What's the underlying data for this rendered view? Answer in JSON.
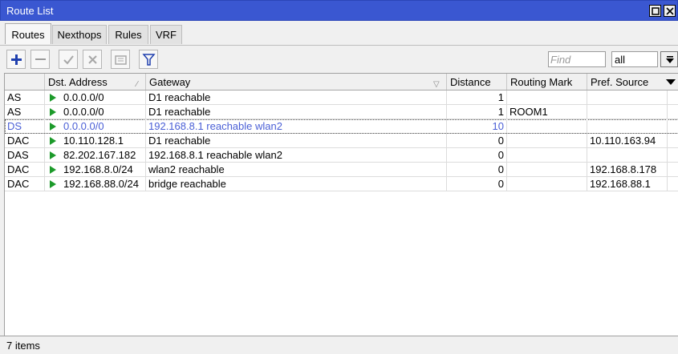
{
  "window": {
    "title": "Route List"
  },
  "tabs": [
    {
      "label": "Routes",
      "active": true
    },
    {
      "label": "Nexthops",
      "active": false
    },
    {
      "label": "Rules",
      "active": false
    },
    {
      "label": "VRF",
      "active": false
    }
  ],
  "toolbar": {
    "buttons": [
      "add-icon",
      "remove-icon",
      "enable-icon",
      "disable-icon",
      "comment-icon",
      "filter-icon"
    ],
    "find_placeholder": "Find",
    "filter_select_value": "all"
  },
  "columns": [
    "",
    "Dst. Address",
    "Gateway",
    "Distance",
    "Routing Mark",
    "Pref. Source"
  ],
  "rows": [
    {
      "flags": "AS",
      "dst": "0.0.0.0/0",
      "gateway": "D1 reachable",
      "distance": "1",
      "mark": "",
      "pref": "",
      "state": "normal"
    },
    {
      "flags": "AS",
      "dst": "0.0.0.0/0",
      "gateway": "D1 reachable",
      "distance": "1",
      "mark": "ROOM1",
      "pref": "",
      "state": "normal"
    },
    {
      "flags": "DS",
      "dst": "0.0.0.0/0",
      "gateway": "192.168.8.1 reachable wlan2",
      "distance": "10",
      "mark": "",
      "pref": "",
      "state": "selected-dim"
    },
    {
      "flags": "DAC",
      "dst": "10.110.128.1",
      "gateway": "D1 reachable",
      "distance": "0",
      "mark": "",
      "pref": "10.110.163.94",
      "state": "normal"
    },
    {
      "flags": "DAS",
      "dst": "82.202.167.182",
      "gateway": "192.168.8.1 reachable wlan2",
      "distance": "0",
      "mark": "",
      "pref": "",
      "state": "normal"
    },
    {
      "flags": "DAC",
      "dst": "192.168.8.0/24",
      "gateway": "wlan2 reachable",
      "distance": "0",
      "mark": "",
      "pref": "192.168.8.178",
      "state": "normal"
    },
    {
      "flags": "DAC",
      "dst": "192.168.88.0/24",
      "gateway": "bridge reachable",
      "distance": "0",
      "mark": "",
      "pref": "192.168.88.1",
      "state": "normal"
    }
  ],
  "status": {
    "items_text": "7 items"
  },
  "colors": {
    "title_bar": "#3a57d1",
    "route_active_icon": "#1c9a2a",
    "dim_text": "#4a5fd6"
  }
}
